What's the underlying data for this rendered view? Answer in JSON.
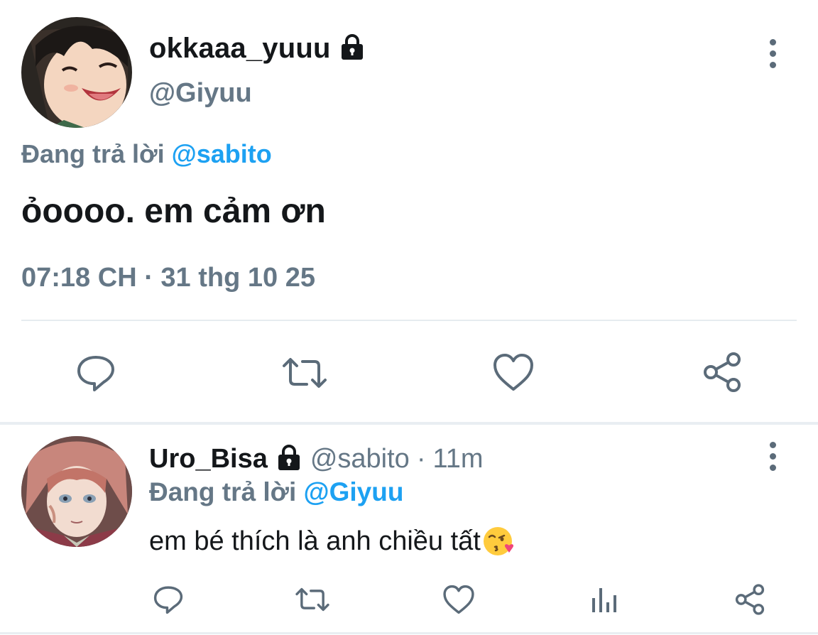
{
  "main_tweet": {
    "display_name": "okkaaa_yuuu",
    "handle": "@Giyuu",
    "replying_prefix": "Đang trả lời",
    "replying_mention": "@sabito",
    "text": "ỏoooo. em cảm ơn",
    "timestamp": "07:18 CH · 31 thg 10 25",
    "actions": [
      "reply-icon",
      "retweet-icon",
      "like-icon",
      "share-icon"
    ]
  },
  "reply_tweet": {
    "display_name": "Uro_Bisa",
    "handle": "@sabito",
    "separator": "·",
    "time": "11m",
    "replying_prefix": "Đang trả lời",
    "replying_mention": "@Giyuu",
    "text": "em bé thích là anh chiều tất",
    "emoji": "face-blowing-kiss",
    "actions": [
      "reply-icon",
      "retweet-icon",
      "like-icon",
      "analytics-icon",
      "share-icon"
    ]
  },
  "colors": {
    "text_primary": "#14171a",
    "text_secondary": "#657786",
    "accent": "#1da1f2",
    "icon": "#5b6b79",
    "divider": "#e6ecf0"
  }
}
